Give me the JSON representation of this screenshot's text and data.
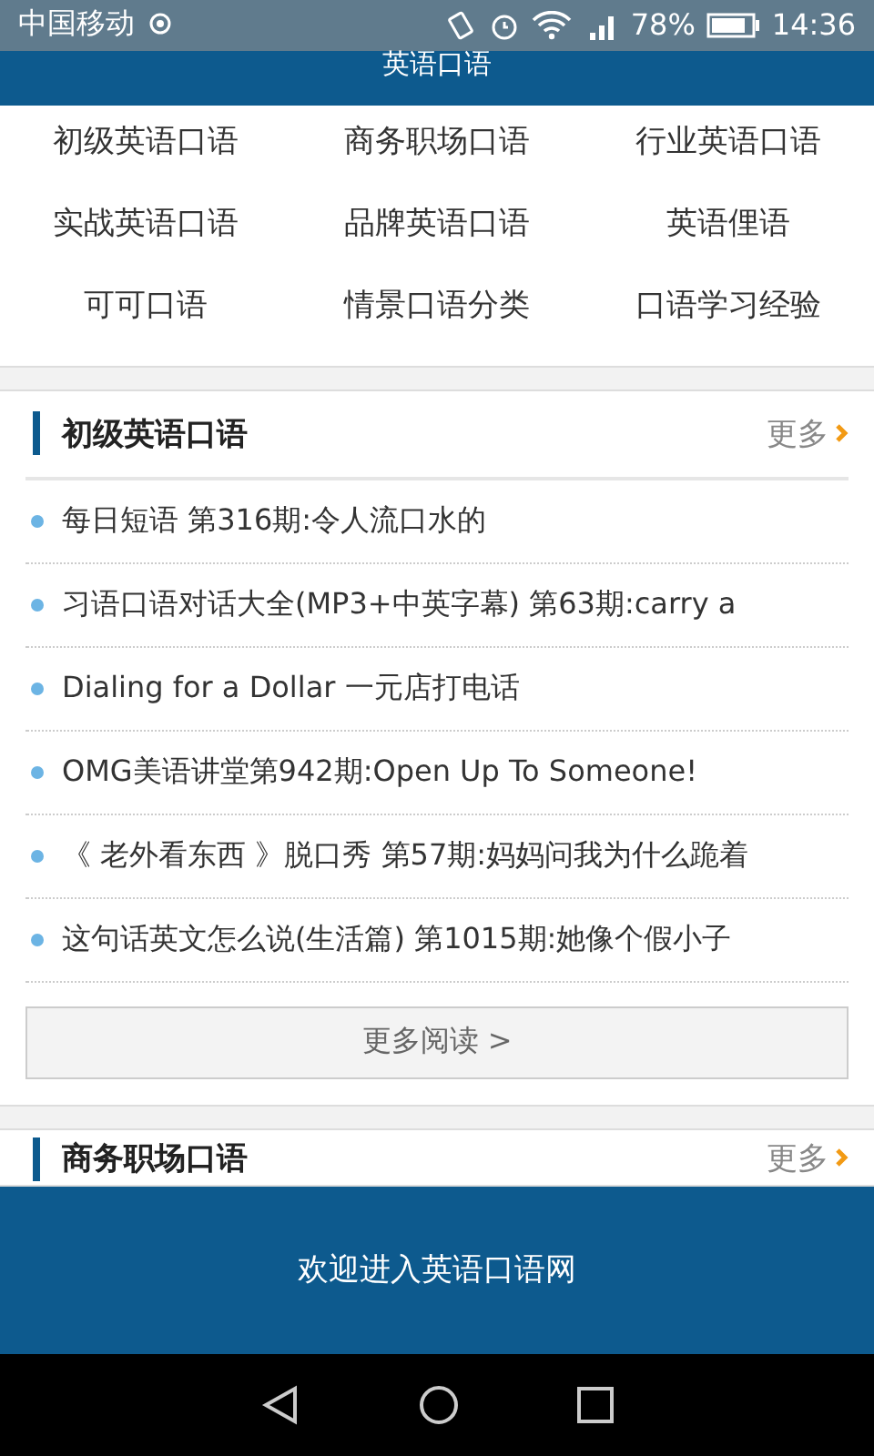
{
  "status_bar": {
    "carrier": "中国移动",
    "battery": "78%",
    "time": "14:36"
  },
  "header": {
    "title": "英语口语"
  },
  "categories": [
    "初级英语口语",
    "商务职场口语",
    "行业英语口语",
    "实战英语口语",
    "品牌英语口语",
    "英语俚语",
    "可可口语",
    "情景口语分类",
    "口语学习经验"
  ],
  "sections": [
    {
      "title": "初级英语口语",
      "more": "更多",
      "articles": [
        "每日短语 第316期:令人流口水的",
        "习语口语对话大全(MP3+中英字幕) 第63期:carry a",
        "Dialing for a Dollar 一元店打电话",
        "OMG美语讲堂第942期:Open Up To Someone!",
        "《 老外看东西 》脱口秀 第57期:妈妈问我为什么跪着",
        "这句话英文怎么说(生活篇) 第1015期:她像个假小子"
      ],
      "read_more": "更多阅读 >"
    },
    {
      "title": "商务职场口语",
      "more": "更多"
    }
  ],
  "banner": {
    "text": "欢迎进入英语口语网"
  }
}
